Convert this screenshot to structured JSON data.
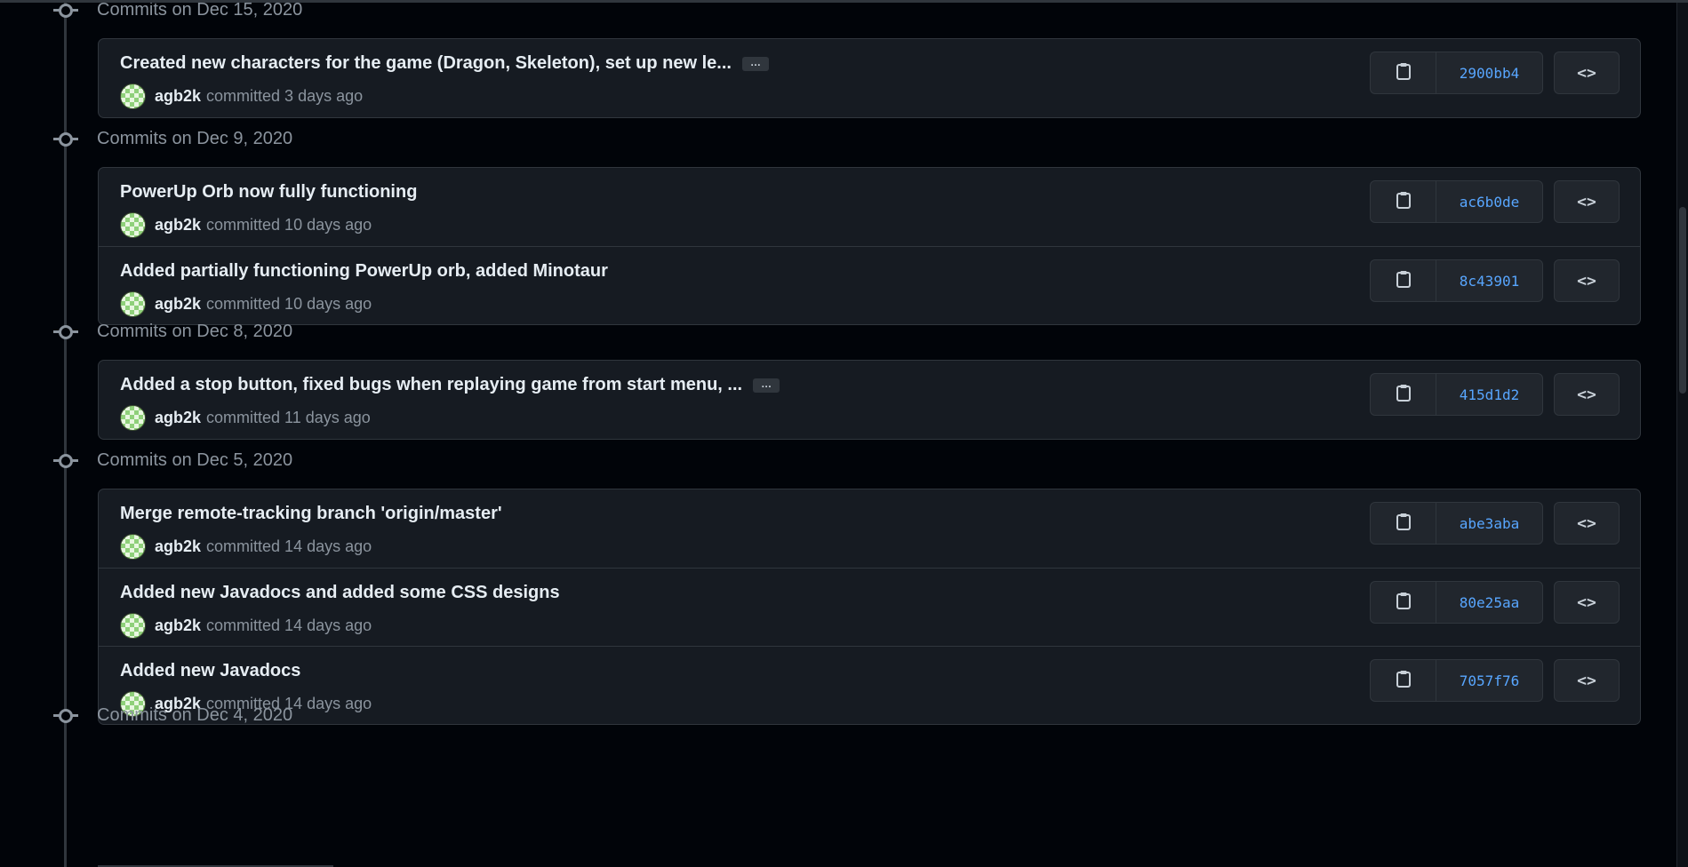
{
  "groups": [
    {
      "title": "Commits on Dec 15, 2020",
      "commits": [
        {
          "message": "Created new characters for the game (Dragon, Skeleton), set up new le...",
          "has_more": true,
          "author": "agb2k",
          "meta": "committed 3 days ago",
          "sha": "2900bb4"
        }
      ]
    },
    {
      "title": "Commits on Dec 9, 2020",
      "commits": [
        {
          "message": "PowerUp Orb now fully functioning",
          "has_more": false,
          "author": "agb2k",
          "meta": "committed 10 days ago",
          "sha": "ac6b0de"
        },
        {
          "message": "Added partially functioning PowerUp orb, added Minotaur",
          "has_more": false,
          "author": "agb2k",
          "meta": "committed 10 days ago",
          "sha": "8c43901"
        }
      ]
    },
    {
      "title": "Commits on Dec 8, 2020",
      "commits": [
        {
          "message": "Added a stop button, fixed bugs when replaying game from start menu, ...",
          "has_more": true,
          "author": "agb2k",
          "meta": "committed 11 days ago",
          "sha": "415d1d2"
        }
      ]
    },
    {
      "title": "Commits on Dec 5, 2020",
      "commits": [
        {
          "message": "Merge remote-tracking branch 'origin/master'",
          "has_more": false,
          "author": "agb2k",
          "meta": "committed 14 days ago",
          "sha": "abe3aba"
        },
        {
          "message": "Added new Javadocs and added some CSS designs",
          "has_more": false,
          "author": "agb2k",
          "meta": "committed 14 days ago",
          "sha": "80e25aa"
        },
        {
          "message": "Added new Javadocs",
          "has_more": false,
          "author": "agb2k",
          "meta": "committed 14 days ago",
          "sha": "7057f76"
        }
      ]
    },
    {
      "title": "Commits on Dec 4, 2020",
      "commits": []
    }
  ],
  "labels": {
    "ellipsis": "…",
    "browse_glyph": "<>"
  },
  "icons": {
    "node": "git-commit-icon",
    "copy": "clipboard-icon",
    "browse": "code-icon",
    "avatar": "identicon-avatar"
  },
  "colors": {
    "background": "#010409",
    "box_bg": "#161b22",
    "border": "#30363d",
    "sha_link": "#58a6ff",
    "muted": "#8b949e",
    "text": "#e6edf3"
  }
}
